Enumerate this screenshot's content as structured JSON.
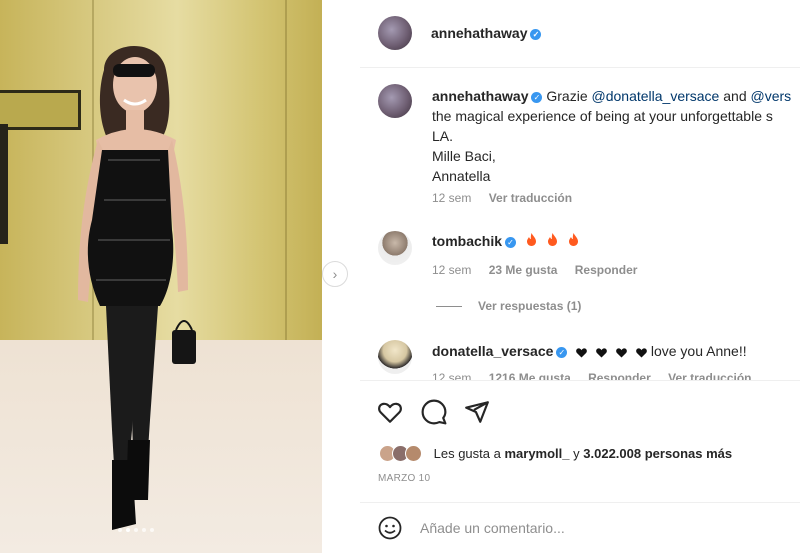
{
  "post": {
    "author": "annehathaway",
    "caption_lines": [
      "Grazie @donatella_versace and @vers",
      "the magical experience of being at your unforgettable s",
      "LA.",
      "Mille Baci,",
      "Annatella"
    ],
    "caption_mention_1": "@donatella_versace",
    "caption_mention_2": "@vers",
    "caption_and": "and",
    "caption_grazie": "Grazie",
    "caption_time": "12 sem",
    "caption_translate": "Ver traducción"
  },
  "comments": [
    {
      "user": "tombachik",
      "text_icons": [
        "fire-icon",
        "fire-icon",
        "fire-icon"
      ],
      "time": "12 sem",
      "likes": "23 Me gusta",
      "reply": "Responder",
      "view_replies": "Ver respuestas (1)"
    },
    {
      "user": "donatella_versace",
      "text_icons": [
        "black-heart-icon",
        "black-heart-icon",
        "black-heart-icon",
        "black-heart-icon"
      ],
      "text": "love you Anne!!",
      "time": "12 sem",
      "likes": "1216 Me gusta",
      "reply": "Responder",
      "translate": "Ver traducción"
    }
  ],
  "likes": {
    "prefix": "Les gusta a",
    "user": "marymoll_",
    "middle": "y",
    "count": "3.022.008 personas más"
  },
  "date": "MARZO 10",
  "add_comment_placeholder": "Añade un comentario...",
  "carousel": {
    "dot_count": 5,
    "active_index": 1
  },
  "colors": {
    "verified": "#3897f0",
    "mention": "#00376b",
    "fire": "#ff5a1f"
  }
}
